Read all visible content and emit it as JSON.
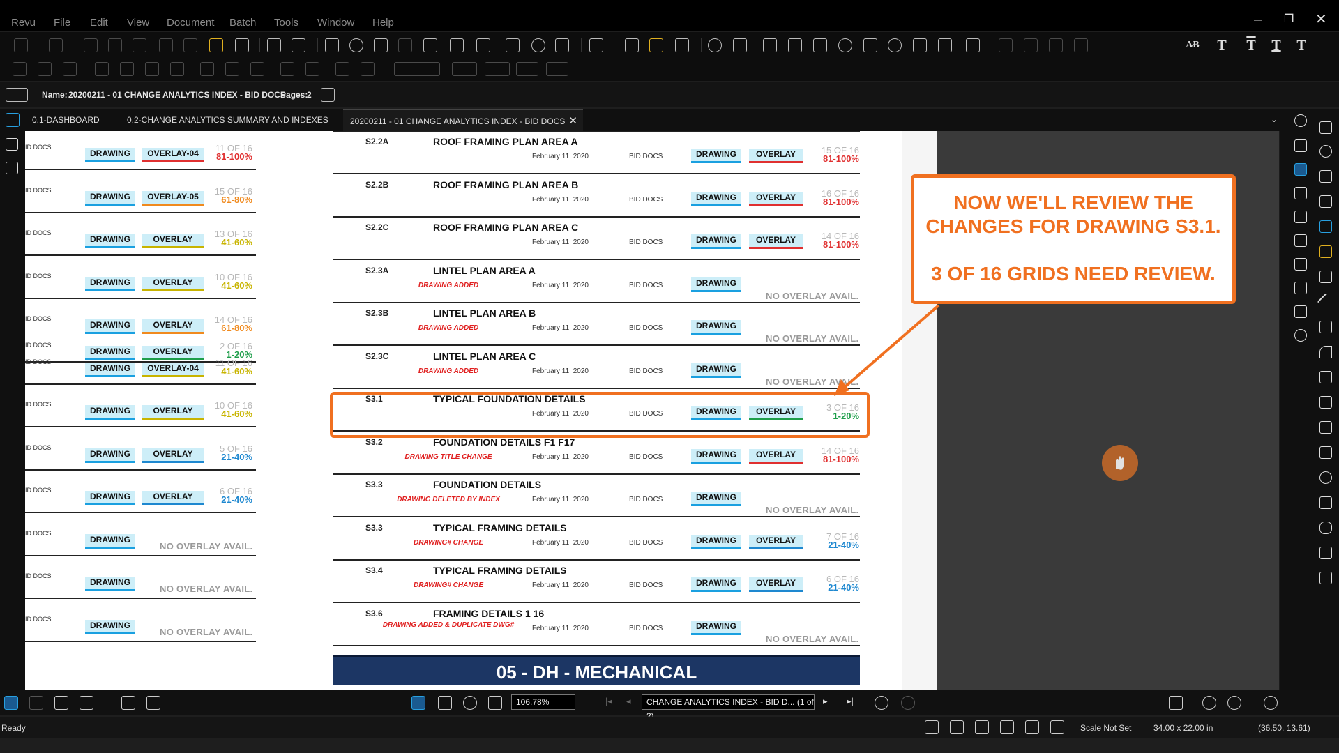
{
  "app": {
    "name": "Revu"
  },
  "menu": [
    "File",
    "Edit",
    "View",
    "Document",
    "Batch",
    "Tools",
    "Window",
    "Help"
  ],
  "window_controls": {
    "minimize": "–",
    "restore": "❐",
    "close": "✕"
  },
  "docinfo": {
    "name_label": "Name:",
    "name_value": "20200211 - 01 CHANGE ANALYTICS INDEX - BID DOCS",
    "pages_label": "Pages:",
    "pages_value": "2"
  },
  "tabs": [
    {
      "label": "0.1-DASHBOARD"
    },
    {
      "label": "0.2-CHANGE ANALYTICS SUMMARY AND INDEXES"
    },
    {
      "label": "20200211 - 01 CHANGE ANALYTICS INDEX - BID DOCS",
      "close": "✕"
    }
  ],
  "text_tools": {
    "spell": "A̷B",
    "t1": "T",
    "t2": "T",
    "t3": "T",
    "t4": "T"
  },
  "left_rows": [
    {
      "bid": "BID DOCS",
      "drawing": "DRAWING",
      "overlay": "OVERLAY-04",
      "count": "11 OF 16",
      "pct": "81-100%",
      "color": "#e03030"
    },
    {
      "bid": "BID DOCS",
      "drawing": "DRAWING",
      "overlay": "OVERLAY-05",
      "count": "15 OF 16",
      "pct": "61-80%",
      "color": "#f08a1e"
    },
    {
      "bid": "BID DOCS",
      "drawing": "DRAWING",
      "overlay": "OVERLAY",
      "count": "13 OF 16",
      "pct": "41-60%",
      "color": "#c8b400"
    },
    {
      "bid": "BID DOCS",
      "drawing": "DRAWING",
      "overlay": "OVERLAY",
      "count": "10 OF 16",
      "pct": "41-60%",
      "color": "#c8b400"
    },
    {
      "bid": "BID DOCS",
      "drawing": "DRAWING",
      "overlay": "OVERLAY",
      "count": "14 OF 16",
      "pct": "61-80%",
      "color": "#f08a1e",
      "extra": {
        "bid": "BID DOCS",
        "drawing": "DRAWING",
        "overlay": "OVERLAY",
        "count": "2 OF 16",
        "pct": "1-20%",
        "color": "#1e9e4a"
      }
    },
    {
      "bid": "BID DOCS",
      "drawing": "DRAWING",
      "overlay": "OVERLAY-04",
      "count": "11 OF 16",
      "pct": "41-60%",
      "color": "#c8b400"
    },
    {
      "bid": "BID DOCS",
      "drawing": "DRAWING",
      "overlay": "OVERLAY",
      "count": "10 OF 16",
      "pct": "41-60%",
      "color": "#c8b400"
    },
    {
      "bid": "BID DOCS",
      "drawing": "DRAWING",
      "overlay": "OVERLAY",
      "count": "5 OF 16",
      "pct": "21-40%",
      "color": "#1e88d0"
    },
    {
      "bid": "BID DOCS",
      "drawing": "DRAWING",
      "overlay": "OVERLAY",
      "count": "6 OF 16",
      "pct": "21-40%",
      "color": "#1e88d0"
    },
    {
      "bid": "BID DOCS",
      "drawing": "DRAWING",
      "noov": "NO OVERLAY AVAIL."
    },
    {
      "bid": "BID DOCS",
      "drawing": "DRAWING",
      "noov": "NO OVERLAY AVAIL."
    },
    {
      "bid": "BID DOCS",
      "drawing": "DRAWING",
      "noov": "NO OVERLAY AVAIL."
    }
  ],
  "right_rows": [
    {
      "code": "S2.2A",
      "title": "ROOF FRAMING PLAN AREA A",
      "change": "",
      "date": "February 11, 2020",
      "bid": "BID DOCS",
      "drawing": "DRAWING",
      "overlay": "OVERLAY",
      "count": "15 OF 16",
      "pct": "81-100%",
      "color": "#e03030"
    },
    {
      "code": "S2.2B",
      "title": "ROOF FRAMING PLAN AREA B",
      "change": "",
      "date": "February 11, 2020",
      "bid": "BID DOCS",
      "drawing": "DRAWING",
      "overlay": "OVERLAY",
      "count": "16 OF 16",
      "pct": "81-100%",
      "color": "#e03030"
    },
    {
      "code": "S2.2C",
      "title": "ROOF FRAMING PLAN AREA C",
      "change": "",
      "date": "February 11, 2020",
      "bid": "BID DOCS",
      "drawing": "DRAWING",
      "overlay": "OVERLAY",
      "count": "14 OF 16",
      "pct": "81-100%",
      "color": "#e03030"
    },
    {
      "code": "S2.3A",
      "title": "LINTEL PLAN AREA A",
      "change": "DRAWING ADDED",
      "date": "February 11, 2020",
      "bid": "BID DOCS",
      "drawing": "DRAWING",
      "noov": "NO OVERLAY AVAIL."
    },
    {
      "code": "S2.3B",
      "title": "LINTEL PLAN AREA B",
      "change": "DRAWING ADDED",
      "date": "February 11, 2020",
      "bid": "BID DOCS",
      "drawing": "DRAWING",
      "noov": "NO OVERLAY AVAIL."
    },
    {
      "code": "S2.3C",
      "title": "LINTEL PLAN AREA C",
      "change": "DRAWING ADDED",
      "date": "February 11, 2020",
      "bid": "BID DOCS",
      "drawing": "DRAWING",
      "noov": "NO OVERLAY AVAIL."
    },
    {
      "code": "S3.1",
      "title": "TYPICAL FOUNDATION DETAILS",
      "change": "",
      "date": "February 11, 2020",
      "bid": "BID DOCS",
      "drawing": "DRAWING",
      "overlay": "OVERLAY",
      "count": "3 OF 16",
      "pct": "1-20%",
      "color": "#1e9e4a"
    },
    {
      "code": "S3.2",
      "title": "FOUNDATION DETAILS F1 F17",
      "change": "DRAWING TITLE CHANGE",
      "date": "February 11, 2020",
      "bid": "BID DOCS",
      "drawing": "DRAWING",
      "overlay": "OVERLAY",
      "count": "14 OF 16",
      "pct": "81-100%",
      "color": "#e03030"
    },
    {
      "code": "S3.3",
      "title": "FOUNDATION DETAILS",
      "change": "DRAWING DELETED BY INDEX",
      "date": "February 11, 2020",
      "bid": "BID DOCS",
      "drawing": "DRAWING",
      "noov": "NO OVERLAY AVAIL."
    },
    {
      "code": "S3.3",
      "title": "TYPICAL FRAMING DETAILS",
      "change": "DRAWING# CHANGE",
      "date": "February 11, 2020",
      "bid": "BID DOCS",
      "drawing": "DRAWING",
      "overlay": "OVERLAY",
      "count": "7 OF 16",
      "pct": "21-40%",
      "color": "#1e88d0"
    },
    {
      "code": "S3.4",
      "title": "TYPICAL FRAMING DETAILS",
      "change": "DRAWING# CHANGE",
      "date": "February 11, 2020",
      "bid": "BID DOCS",
      "drawing": "DRAWING",
      "overlay": "OVERLAY",
      "count": "6 OF 16",
      "pct": "21-40%",
      "color": "#1e88d0"
    },
    {
      "code": "S3.6",
      "title": "FRAMING DETAILS 1 16",
      "change": "DRAWING ADDED & DUPLICATE DWG#",
      "date": "February 11, 2020",
      "bid": "BID DOCS",
      "drawing": "DRAWING",
      "noov": "NO OVERLAY AVAIL."
    }
  ],
  "section_header": "05 - DH - MECHANICAL",
  "callout": {
    "line1": "NOW WE'LL REVIEW THE",
    "line2": "CHANGES FOR DRAWING S3.1.",
    "line3": "3 OF 16 GRIDS NEED REVIEW."
  },
  "bottombar": {
    "zoom": "106.78%",
    "page_select": "CHANGE ANALYTICS INDEX - BID D...",
    "page_count": "(1 of 2)"
  },
  "status": {
    "ready": "Ready",
    "scale": "Scale Not Set",
    "size": "34.00 x 22.00 in",
    "coords": "(36.50, 13.61)"
  },
  "colors": {
    "accent_orange": "#f07020",
    "header_blue": "#1c3664",
    "button_bg": "#cdeef8",
    "button_line": "#1aa0e0"
  }
}
